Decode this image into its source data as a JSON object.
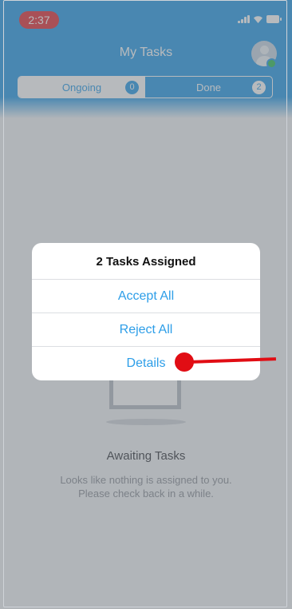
{
  "status_bar": {
    "time": "2:37"
  },
  "nav": {
    "title": "My Tasks"
  },
  "tabs": [
    {
      "label": "Ongoing",
      "count": "0",
      "selected": true
    },
    {
      "label": "Done",
      "count": "2",
      "selected": false
    }
  ],
  "empty_state": {
    "title": "Awaiting Tasks",
    "message_line1": "Looks like nothing is assigned to you.",
    "message_line2": "Please check back in a while."
  },
  "alert": {
    "title": "2 Tasks Assigned",
    "actions": [
      "Accept All",
      "Reject All",
      "Details"
    ]
  },
  "colors": {
    "accent": "#2d9ee8",
    "status_pill": "#e5343d",
    "online": "#35c05a",
    "annotation": "#e10d14"
  },
  "icons": [
    "cellular-signal-icon",
    "wifi-icon",
    "battery-icon",
    "avatar-icon",
    "empty-box-icon"
  ]
}
